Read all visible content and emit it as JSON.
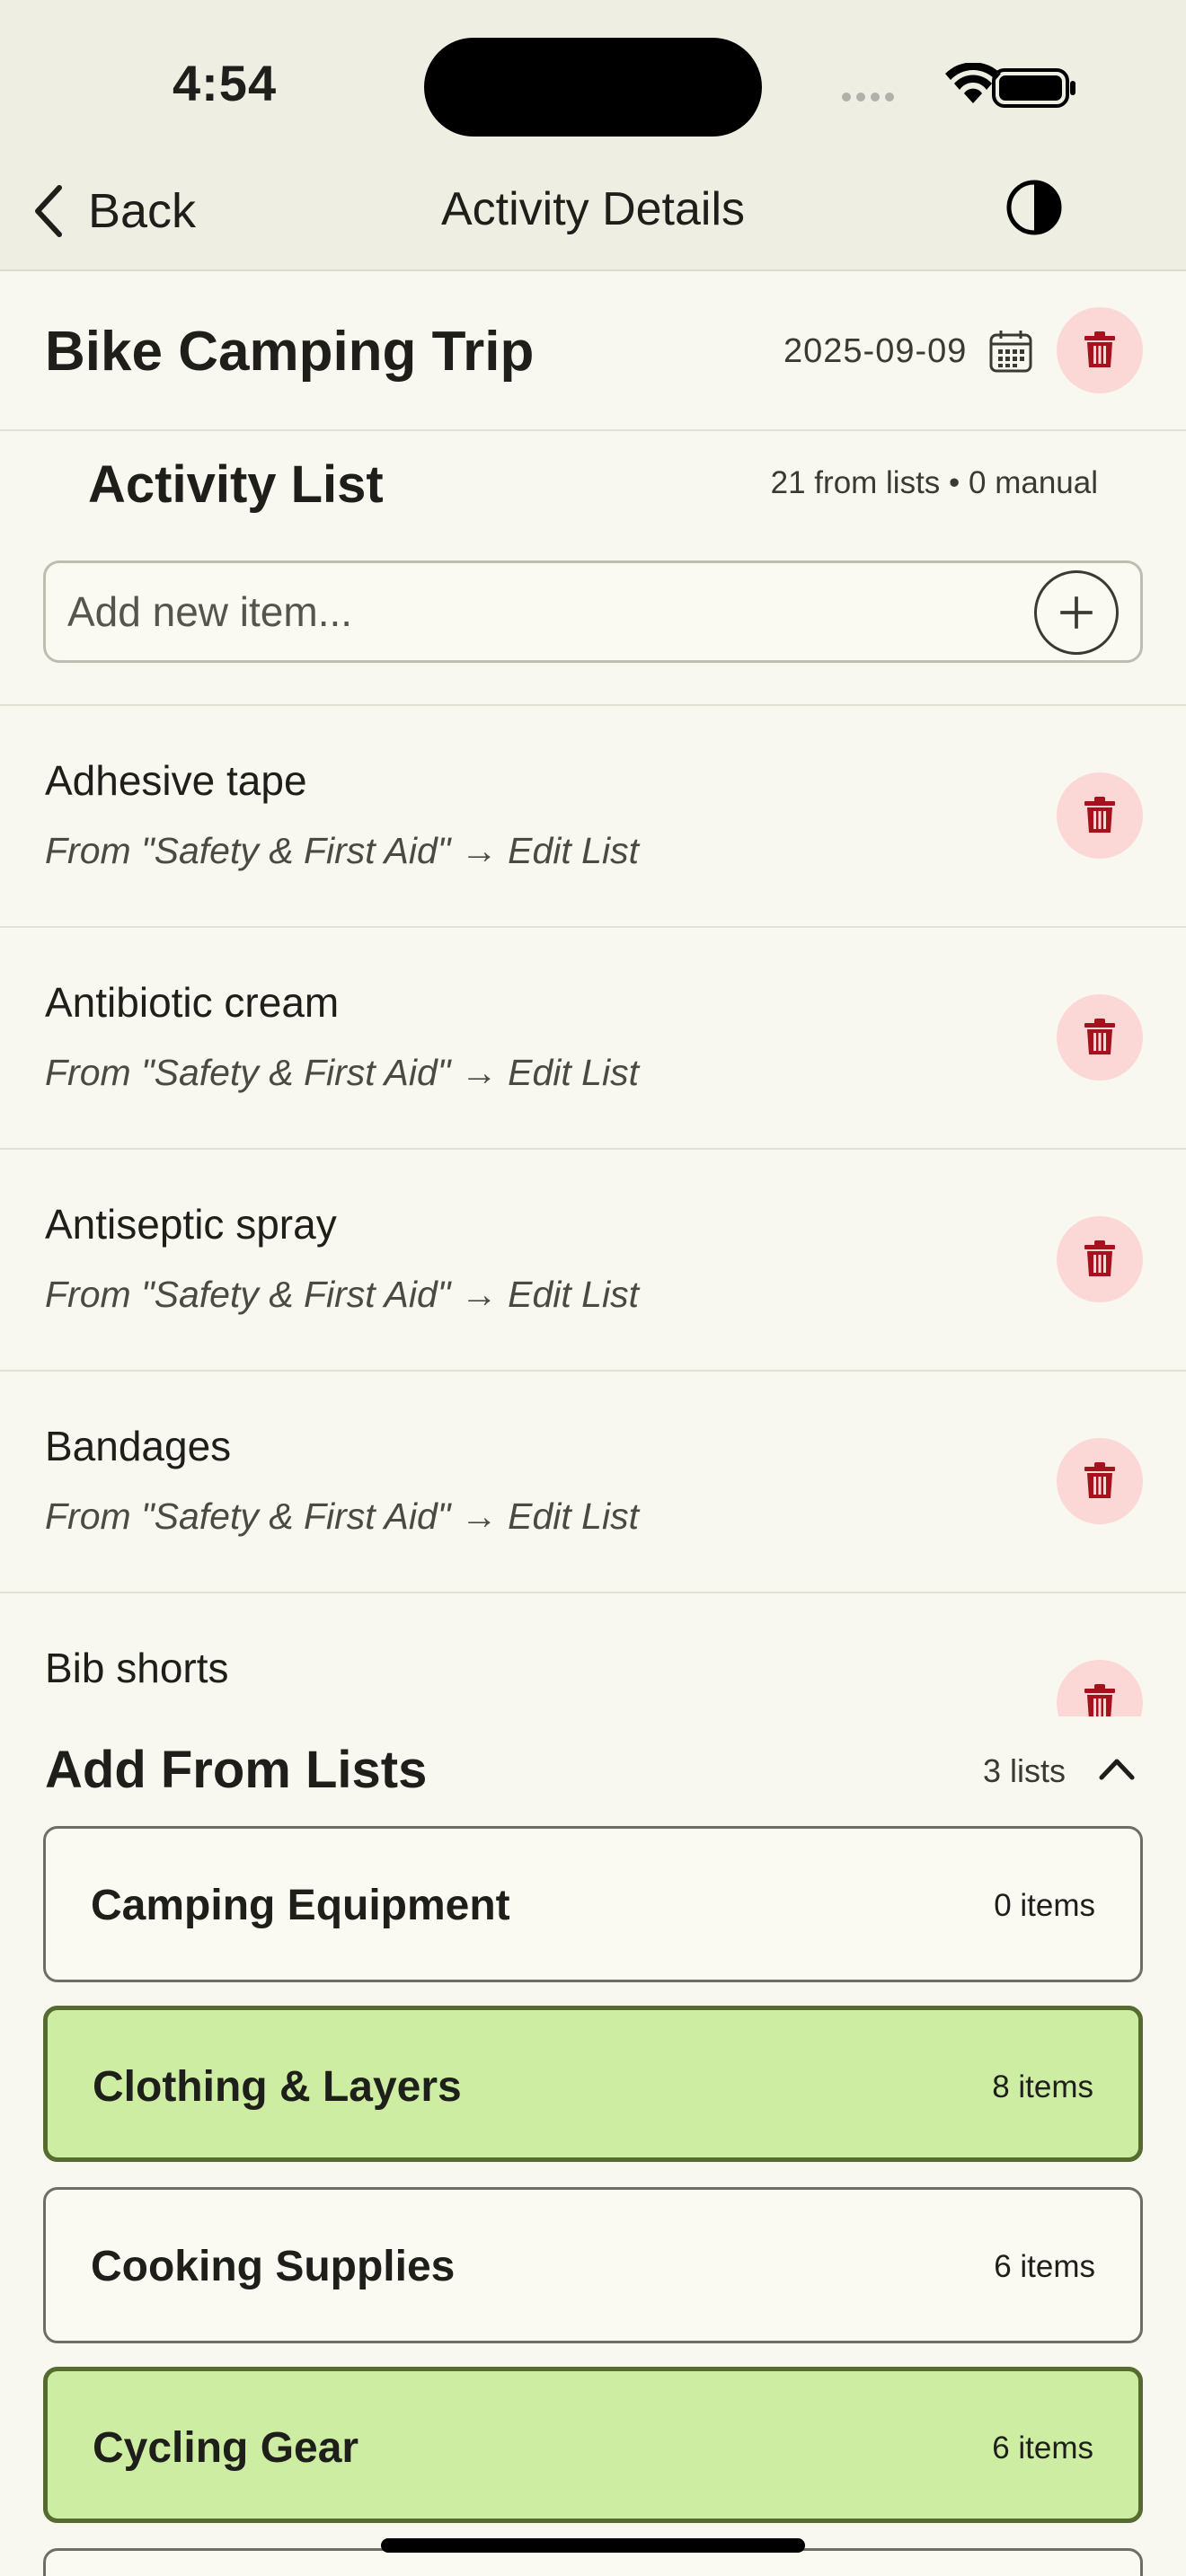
{
  "status_bar": {
    "time": "4:54"
  },
  "nav": {
    "back_label": "Back",
    "title": "Activity Details"
  },
  "activity": {
    "title": "Bike Camping Trip",
    "date": "2025-09-09"
  },
  "activity_list": {
    "title": "Activity List",
    "counts": "21 from lists • 0 manual",
    "input_placeholder": "Add new item...",
    "items": [
      {
        "name": "Adhesive tape",
        "source": "From \"Safety & First Aid\" → Edit List"
      },
      {
        "name": "Antibiotic cream",
        "source": "From \"Safety & First Aid\" → Edit List"
      },
      {
        "name": "Antiseptic spray",
        "source": "From \"Safety & First Aid\" → Edit List"
      },
      {
        "name": "Bandages",
        "source": "From \"Safety & First Aid\" → Edit List"
      },
      {
        "name": "Bib shorts",
        "source": ""
      }
    ]
  },
  "add_from_lists": {
    "title": "Add From Lists",
    "count": "3 lists",
    "lists": [
      {
        "name": "Camping Equipment",
        "count": "0 items",
        "selected": false
      },
      {
        "name": "Clothing & Layers",
        "count": "8 items",
        "selected": true
      },
      {
        "name": "Cooking Supplies",
        "count": "6 items",
        "selected": false
      },
      {
        "name": "Cycling Gear",
        "count": "6 items",
        "selected": true
      }
    ]
  },
  "colors": {
    "background": "#F8F8F0",
    "topbar": "#EEEEE2",
    "delete_bg": "#FBD8D6",
    "delete_icon": "#A5111C",
    "selected_bg": "#CDEDA3",
    "selected_border": "#556B2F"
  },
  "icons": [
    "chevron-left-icon",
    "contrast-icon",
    "calendar-icon",
    "trash-icon",
    "plus-icon",
    "chevron-up-icon",
    "wifi-icon",
    "battery-icon",
    "signal-icon"
  ]
}
